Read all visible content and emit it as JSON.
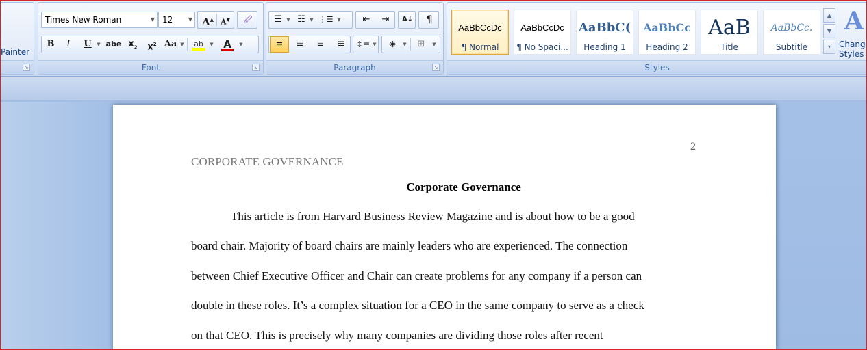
{
  "clipboard": {
    "painter_label": "Painter"
  },
  "font": {
    "name": "Times New Roman",
    "size": "12",
    "grow_glyph": "A",
    "shrink_glyph": "A",
    "bold_glyph": "B",
    "italic_glyph": "I",
    "underline_glyph": "U",
    "strike_glyph": "abe",
    "subscript_glyph": "x",
    "superscript_glyph": "x",
    "case_glyph": "Aa",
    "highlight_glyph": "ab",
    "color_glyph": "A",
    "group_label": "Font",
    "highlight_color": "#ffff00",
    "font_color": "#e00000"
  },
  "paragraph": {
    "group_label": "Paragraph",
    "pilcrow_glyph": "¶"
  },
  "styles": {
    "group_label": "Styles",
    "items": [
      {
        "sample": "AaBbCcDc",
        "name": "¶ Normal",
        "selected": true
      },
      {
        "sample": "AaBbCcDc",
        "name": "¶ No Spaci...",
        "selected": false
      },
      {
        "sample": "AaBbC(",
        "name": "Heading 1",
        "selected": false
      },
      {
        "sample": "AaBbCc",
        "name": "Heading 2",
        "selected": false
      },
      {
        "sample": "AaB",
        "name": "Title",
        "selected": false
      },
      {
        "sample": "AaBbCc.",
        "name": "Subtitle",
        "selected": false
      }
    ],
    "change_styles_label_1": "Chang",
    "change_styles_label_2": "Styles"
  },
  "document": {
    "page_number": "2",
    "running_head": "CORPORATE GOVERNANCE",
    "title": "Corporate Governance",
    "lines": [
      "This article is from Harvard Business Review Magazine and is about how to be a good",
      "board chair. Majority of board chairs are mainly leaders who are experienced. The connection",
      "between Chief Executive Officer and Chair can create problems for any company if a person can",
      "double in these roles. It’s a complex situation for a CEO in the same company to serve as a check",
      "on that CEO. This is precisely why many companies are dividing those roles after recent"
    ]
  }
}
